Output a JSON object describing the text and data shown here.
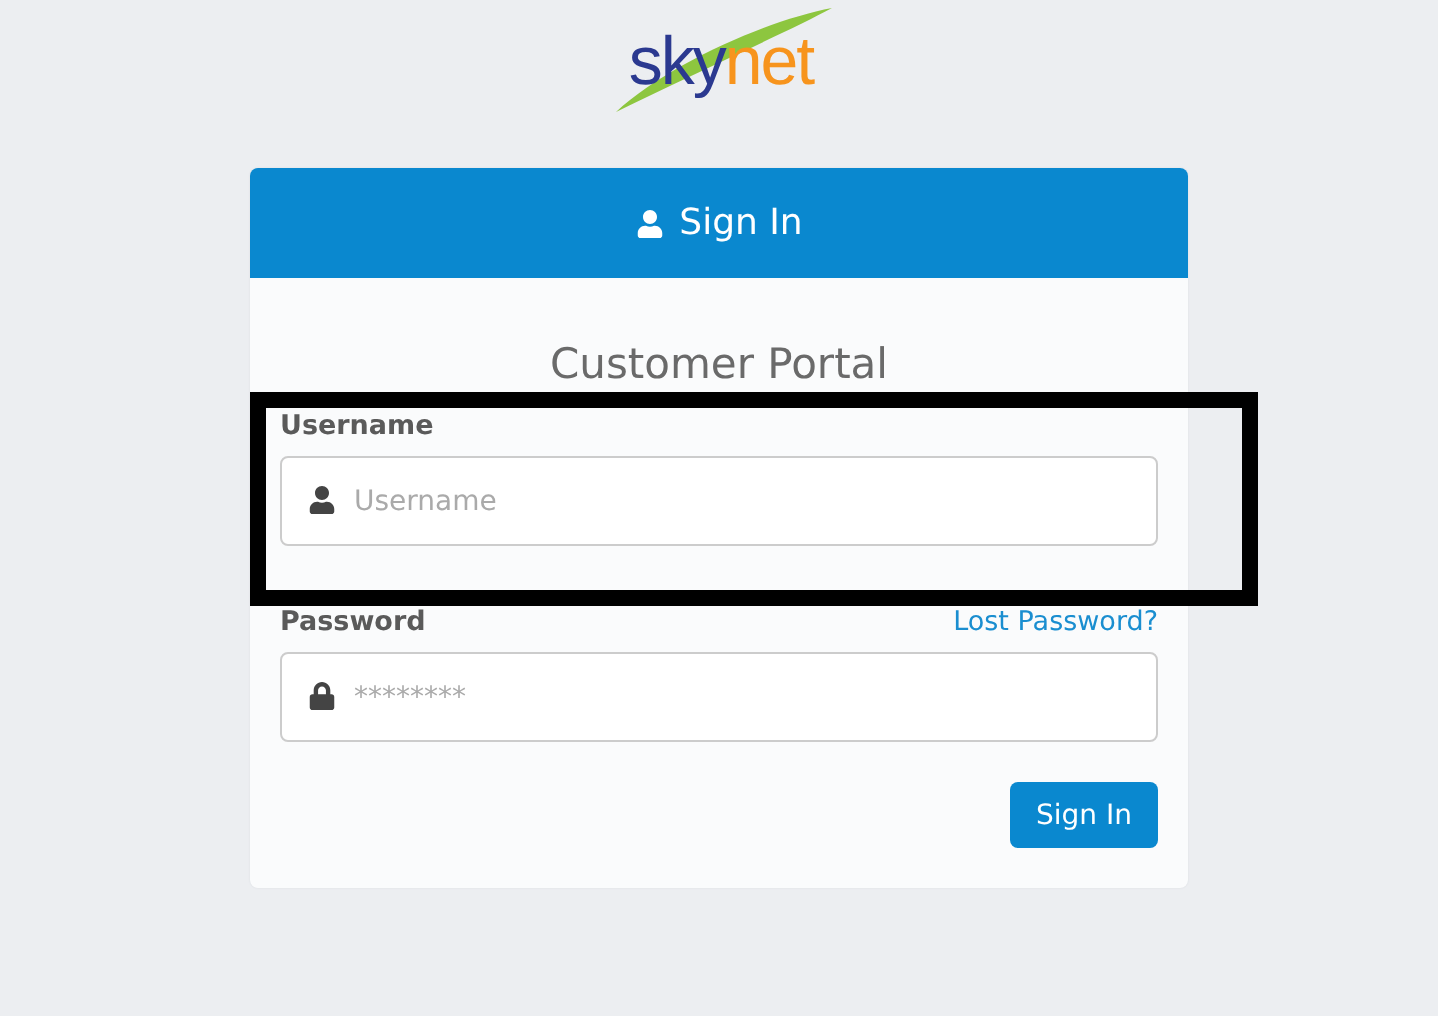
{
  "logo": {
    "text_primary": "sky",
    "text_accent": "net"
  },
  "card": {
    "header": "Sign In",
    "title": "Customer Portal",
    "fields": [
      {
        "label": "Username",
        "placeholder": "Username",
        "kind": "user"
      },
      {
        "label": "Password",
        "placeholder": "********",
        "kind": "password",
        "link": "Lost Password?"
      }
    ],
    "button": "Sign In"
  }
}
